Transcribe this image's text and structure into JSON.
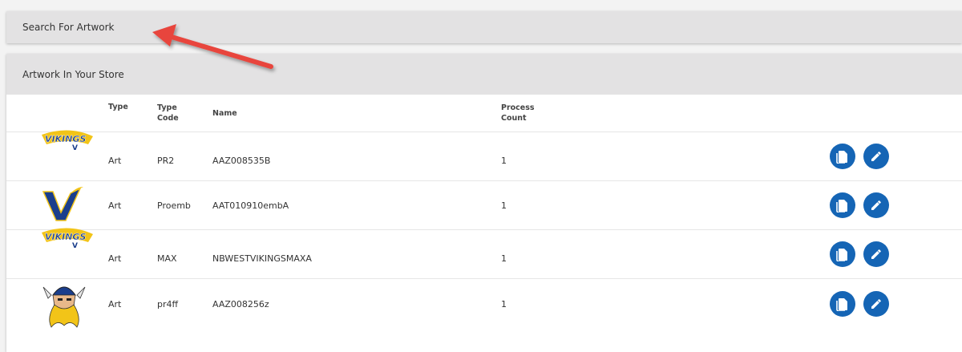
{
  "search_panel": {
    "title": "Search For Artwork"
  },
  "store_panel": {
    "title": "Artwork In Your Store"
  },
  "table": {
    "headers": {
      "type": "Type",
      "type_code": "Type Code",
      "name": "Name",
      "process_count": "Process Count"
    },
    "rows": [
      {
        "logo": "vikings-wordmark-logo",
        "type": "Art",
        "type_code": "PR2",
        "name": "AAZ008535B",
        "process_count": "1"
      },
      {
        "logo": "v-horns-logo",
        "type": "Art",
        "type_code": "Proemb",
        "name": "AAT010910embA",
        "process_count": "1"
      },
      {
        "logo": "vikings-wordmark-logo",
        "type": "Art",
        "type_code": "MAX",
        "name": "NBWESTVIKINGSMAXA",
        "process_count": "1"
      },
      {
        "logo": "viking-head-mascot-logo",
        "type": "Art",
        "type_code": "pr4ff",
        "name": "AAZ008256z",
        "process_count": "1"
      }
    ]
  },
  "colors": {
    "accent": "#1565b5",
    "header_bg": "#e3e2e3",
    "annotation_arrow": "#e8453c"
  },
  "icons": {
    "copy": "copy-document-icon",
    "edit": "pencil-edit-icon"
  }
}
